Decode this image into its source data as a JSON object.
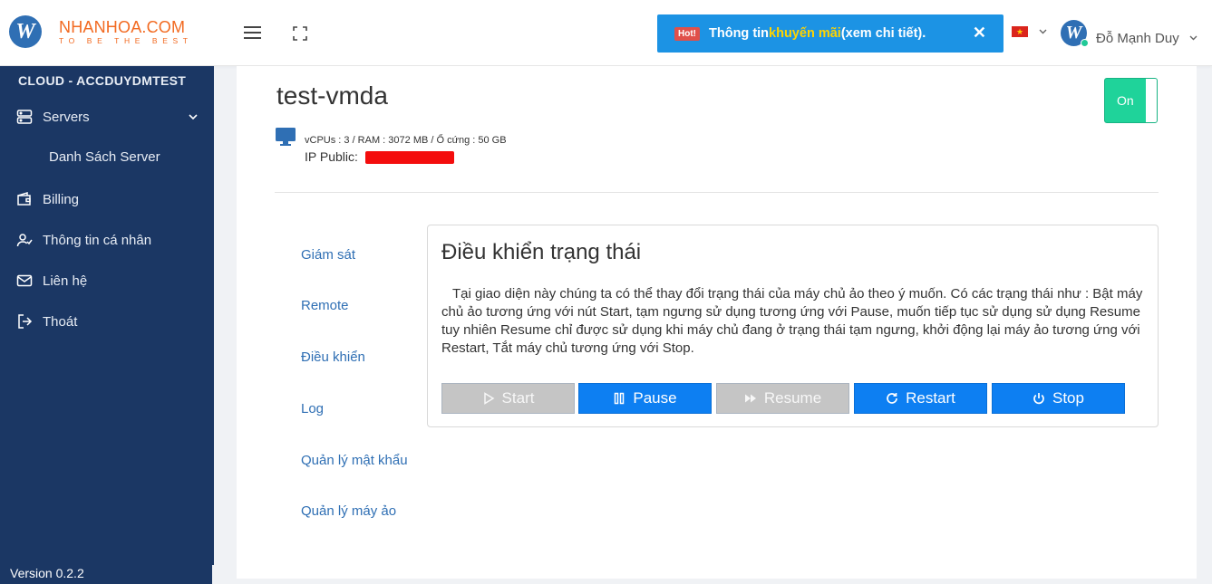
{
  "brand": {
    "logo_letter": "W",
    "name": "NHANHOA.COM",
    "tagline": "TO BE THE BEST"
  },
  "promo": {
    "badge": "Hot!",
    "text_before": "Thông tin ",
    "highlight": "khuyến mãi",
    "text_after": " (xem chi tiết).",
    "close_glyph": "✕",
    "colors": {
      "background": "#1c93e4",
      "highlight": "#ffd400",
      "badge": "#e0504a"
    }
  },
  "user": {
    "avatar_letter": "W",
    "name": "Đỗ Mạnh Duy"
  },
  "sidebar": {
    "title": "CLOUD - ACCDUYDMTEST",
    "items": [
      {
        "label": "Servers",
        "icon": "server-icon"
      },
      {
        "label": "Billing",
        "icon": "wallet-icon"
      },
      {
        "label": "Thông tin cá nhân",
        "icon": "user-check-icon"
      },
      {
        "label": "Liên hệ",
        "icon": "mail-icon"
      },
      {
        "label": "Thoát",
        "icon": "logout-icon"
      }
    ],
    "sub_items": [
      {
        "label": "Danh Sách Server"
      }
    ],
    "version": "Version 0.2.2",
    "color": "#1b3764"
  },
  "vm": {
    "name": "test-vmda",
    "power_label": "On",
    "specs": "vCPUs : 3 / RAM : 3072 MB / Ổ cứng : 50 GB",
    "ip_label": "IP Public:",
    "power_color": "#1fd39a"
  },
  "tabs": [
    {
      "label": "Giám sát"
    },
    {
      "label": "Remote"
    },
    {
      "label": "Điều khiển"
    },
    {
      "label": "Log"
    },
    {
      "label": "Quản lý mật khẩu"
    },
    {
      "label": "Quản lý máy ảo"
    }
  ],
  "control": {
    "title": "Điều khiển trạng thái",
    "description": "Tại giao diện này chúng ta có thể thay đổi trạng thái của máy chủ ảo theo ý muốn. Có các trạng thái như : Bật máy chủ ảo tương ứng với nút Start, tạm ngưng sử dụng tương ứng với Pause, muốn tiếp tục sử dụng sử dụng Resume tuy nhiên Resume chỉ được sử dụng khi máy chủ đang ở trạng thái tạm ngưng, khởi động lại máy ảo tương ứng với Restart, Tắt máy chủ tương ứng với Stop.",
    "buttons": [
      {
        "label": "Start",
        "icon": "play-icon",
        "enabled": false
      },
      {
        "label": "Pause",
        "icon": "pause-icon",
        "enabled": true
      },
      {
        "label": "Resume",
        "icon": "fast-forward-icon",
        "enabled": false
      },
      {
        "label": "Restart",
        "icon": "refresh-icon",
        "enabled": true
      },
      {
        "label": "Stop",
        "icon": "power-icon",
        "enabled": true
      }
    ],
    "colors": {
      "primary": "#0d7ff2",
      "disabled": "#c5c5c5"
    }
  }
}
